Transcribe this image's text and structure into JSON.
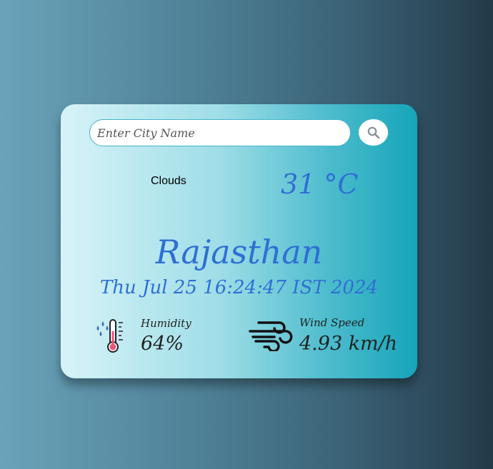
{
  "search": {
    "placeholder": "Enter City Name",
    "value": ""
  },
  "weather": {
    "condition": "Clouds",
    "temperature": "31 °C",
    "city": "Rajasthan",
    "datetime": "Thu Jul 25 16:24:47 IST 2024"
  },
  "details": {
    "humidity_label": "Humidity",
    "humidity_value": "64%",
    "wind_label": "Wind Speed",
    "wind_value": "4.93 km/h"
  },
  "icons": {
    "search": "search-icon",
    "humidity": "thermometer-humidity-icon",
    "wind": "wind-icon"
  },
  "colors": {
    "accent_text": "#2f6fd3",
    "card_border": "#45b5c8"
  }
}
